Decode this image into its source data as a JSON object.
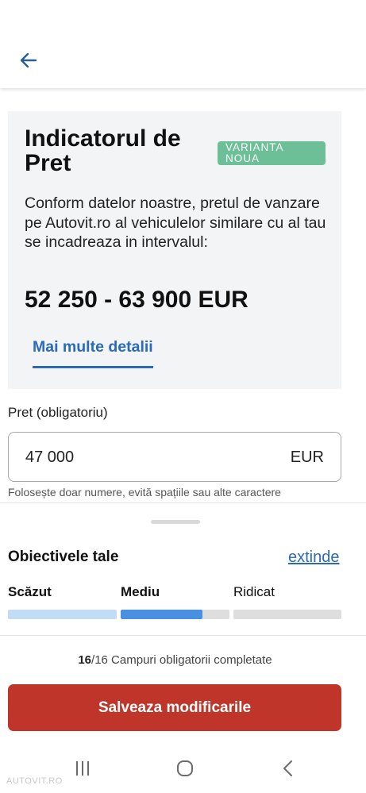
{
  "header": {
    "back_icon": "arrow-left-icon"
  },
  "card": {
    "title": "Indicatorul de Pret",
    "badge": "VARIANTA NOUA",
    "description": "Conform datelor noastre, pretul de vanzare pe Autovit.ro al vehiculelor similare cu al tau se incadreaza in intervalul:",
    "price_range": "52 250 - 63 900 EUR",
    "more_link": "Mai multe detalii"
  },
  "price_field": {
    "label": "Pret (obligatoriu)",
    "value": "47 000",
    "currency": "EUR",
    "hint": "Folosește doar numere, evită spațiile sau alte caractere"
  },
  "goals": {
    "title": "Obiectivele tale",
    "expand_link": "extinde",
    "levels": [
      {
        "label": "Scăzut",
        "fill": 1.0,
        "color": "#c3dcf5"
      },
      {
        "label": "Mediu",
        "fill": 0.75,
        "color": "#4a90e2"
      },
      {
        "label": "Ridicat",
        "fill": 0.0,
        "color": "#dedede"
      }
    ]
  },
  "completion": {
    "done": "16",
    "total_text": "/16 Campuri obligatorii completate"
  },
  "save_button": "Salveaza modificarile",
  "nav": {
    "recents_icon": "recent-apps-icon",
    "home_icon": "home-icon",
    "back_icon": "back-chevron-icon"
  },
  "watermark": "AUTOVIT.RO",
  "colors": {
    "accent": "#2a6ab8",
    "badge": "#6cbf97",
    "primary_button": "#c0352a"
  }
}
